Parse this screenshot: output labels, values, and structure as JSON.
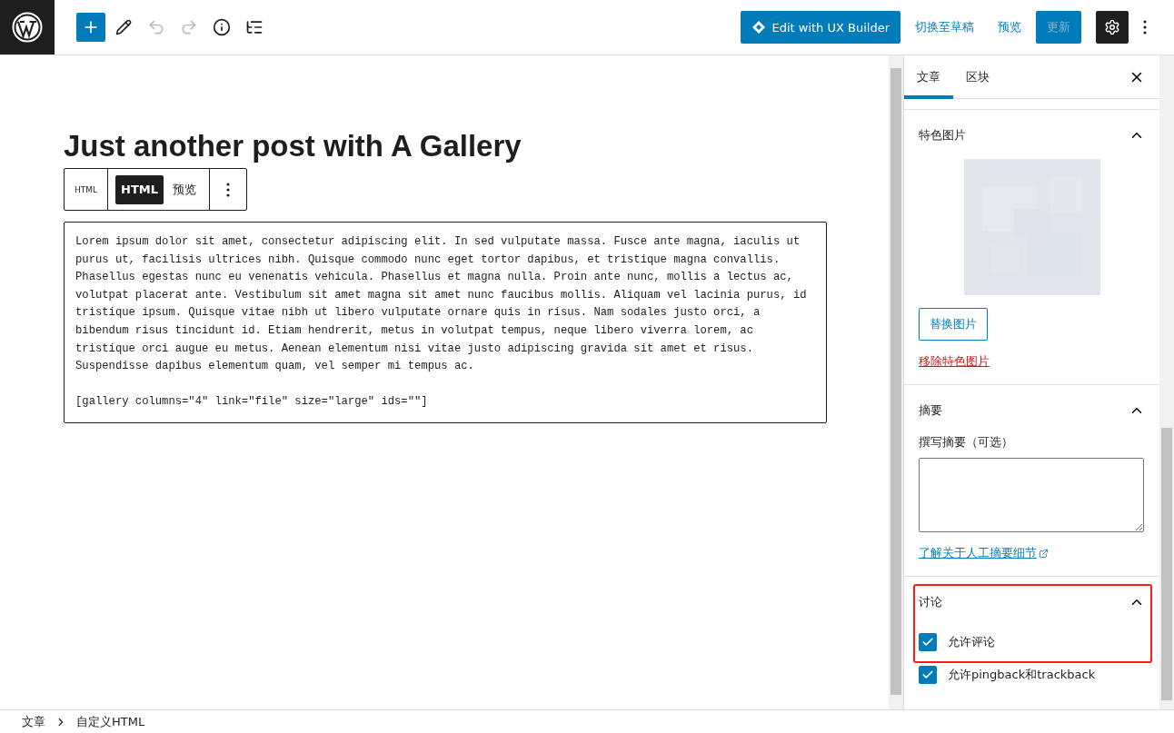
{
  "topbar": {
    "tools": [
      {
        "kind": "add",
        "disabled": false
      },
      {
        "kind": "edit",
        "disabled": false
      },
      {
        "kind": "undo",
        "disabled": true
      },
      {
        "kind": "redo",
        "disabled": true
      },
      {
        "kind": "info",
        "disabled": false
      },
      {
        "kind": "outline",
        "disabled": false
      }
    ],
    "ux_builder": "Edit with UX Builder",
    "draft": "切换至草稿",
    "preview": "预览",
    "update": {
      "label": "更新",
      "disabled": true
    }
  },
  "editor": {
    "title": "Just another post with A Gallery",
    "block_toolbar": {
      "block_label": "HTML",
      "modes": [
        {
          "label": "HTML",
          "selected": true
        },
        {
          "label": "预览",
          "selected": false
        }
      ]
    },
    "code": [
      "Lorem ipsum dolor sit amet, consectetur adipiscing elit. In sed vulputate massa. Fusce ante magna, iaculis ut purus ut, facilisis ultrices nibh. Quisque commodo nunc eget tortor dapibus, et tristique magna convallis. Phasellus egestas nunc eu venenatis vehicula. Phasellus et magna nulla. Proin ante nunc, mollis a lectus ac, volutpat placerat ante. Vestibulum sit amet magna sit amet nunc faucibus mollis. Aliquam vel lacinia purus, id tristique ipsum. Quisque vitae nibh ut libero vulputate ornare quis in risus. Nam sodales justo orci, a bibendum risus tincidunt id. Etiam hendrerit, metus in volutpat tempus, neque libero viverra lorem, ac tristique orci augue eu metus. Aenean elementum nisi vitae justo adipiscing gravida sit amet et risus. Suspendisse dapibus elementum quam, vel semper mi tempus ac.",
      "[gallery columns=\"4\" link=\"file\" size=\"large\" ids=\"\"]"
    ]
  },
  "sidebar": {
    "tabs": [
      {
        "label": "文章",
        "selected": true
      },
      {
        "label": "区块",
        "selected": false
      }
    ],
    "featured_image": {
      "title": "特色图片",
      "expanded": true,
      "replace_button": "替换图片",
      "remove_link": "移除特色图片"
    },
    "excerpt": {
      "title": "摘要",
      "expanded": true,
      "field_label": "撰写摘要（可选）",
      "help_link": "了解关于人工摘要细节"
    },
    "discussion": {
      "title": "讨论",
      "expanded": true,
      "highlighted": true,
      "options": [
        {
          "label": "允许评论",
          "checked": true
        },
        {
          "label": "允许pingback和trackback",
          "checked": true
        }
      ]
    }
  },
  "breadcrumb": [
    "文章",
    "自定义HTML"
  ]
}
